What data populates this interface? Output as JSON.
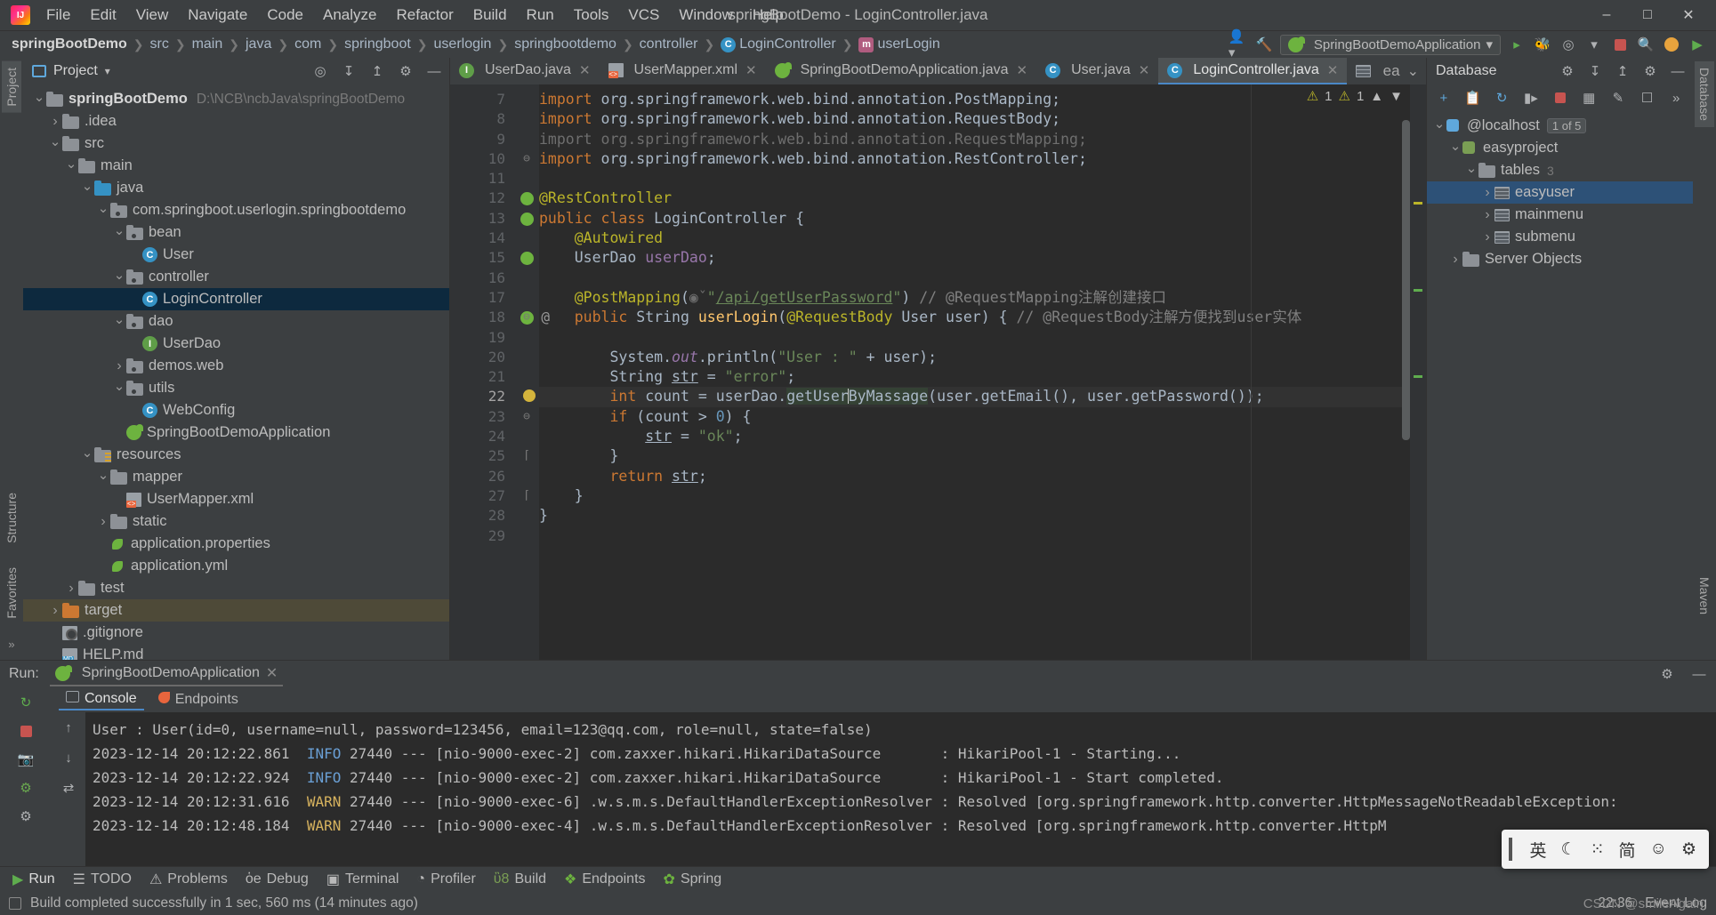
{
  "window": {
    "title": "springBootDemo - LoginController.java",
    "minimize": "–",
    "maximize": "□",
    "close": "✕"
  },
  "menu": [
    "File",
    "Edit",
    "View",
    "Navigate",
    "Code",
    "Analyze",
    "Refactor",
    "Build",
    "Run",
    "Tools",
    "VCS",
    "Window",
    "Help"
  ],
  "breadcrumb": [
    {
      "label": "springBootDemo",
      "bold": true
    },
    {
      "label": "src"
    },
    {
      "label": "main"
    },
    {
      "label": "java"
    },
    {
      "label": "com"
    },
    {
      "label": "springboot"
    },
    {
      "label": "userlogin"
    },
    {
      "label": "springbootdemo"
    },
    {
      "label": "controller"
    },
    {
      "label": "LoginController",
      "icon": "class-icon"
    },
    {
      "label": "userLogin",
      "icon": "method-icon"
    }
  ],
  "navbar_right": {
    "run_config": "SpringBootDemoApplication",
    "icons": [
      "user-settings-icon",
      "hammer-build-icon",
      "run-icon",
      "debug-icon",
      "run-coverage-icon",
      "profiler-icon",
      "stop-icon",
      "search-icon",
      "updates-icon",
      "run-anything-icon"
    ]
  },
  "project_panel": {
    "title": "Project",
    "tools": [
      "select-opened-file-icon",
      "expand-all-icon",
      "collapse-all-icon",
      "settings-icon",
      "hide-icon"
    ],
    "tree": [
      {
        "depth": 0,
        "arrow": "down",
        "icon": "module-folder",
        "name": "springBootDemo",
        "bold": true,
        "path": "D:\\NCB\\ncbJava\\springBootDemo"
      },
      {
        "depth": 1,
        "arrow": "right",
        "icon": "folder",
        "name": ".idea"
      },
      {
        "depth": 1,
        "arrow": "down",
        "icon": "folder",
        "name": "src"
      },
      {
        "depth": 2,
        "arrow": "down",
        "icon": "folder",
        "name": "main"
      },
      {
        "depth": 3,
        "arrow": "down",
        "icon": "folder-blue",
        "name": "java"
      },
      {
        "depth": 4,
        "arrow": "down",
        "icon": "package",
        "name": "com.springboot.userlogin.springbootdemo"
      },
      {
        "depth": 5,
        "arrow": "down",
        "icon": "package",
        "name": "bean"
      },
      {
        "depth": 6,
        "arrow": "none",
        "icon": "class",
        "name": "User"
      },
      {
        "depth": 5,
        "arrow": "down",
        "icon": "package",
        "name": "controller"
      },
      {
        "depth": 6,
        "arrow": "none",
        "icon": "class",
        "name": "LoginController",
        "selected": true
      },
      {
        "depth": 5,
        "arrow": "down",
        "icon": "package",
        "name": "dao"
      },
      {
        "depth": 6,
        "arrow": "none",
        "icon": "interface",
        "name": "UserDao"
      },
      {
        "depth": 5,
        "arrow": "right",
        "icon": "package",
        "name": "demos.web"
      },
      {
        "depth": 5,
        "arrow": "down",
        "icon": "package",
        "name": "utils"
      },
      {
        "depth": 6,
        "arrow": "none",
        "icon": "class",
        "name": "WebConfig"
      },
      {
        "depth": 5,
        "arrow": "none",
        "icon": "spring",
        "name": "SpringBootDemoApplication"
      },
      {
        "depth": 3,
        "arrow": "down",
        "icon": "resource-folder",
        "name": "resources"
      },
      {
        "depth": 4,
        "arrow": "down",
        "icon": "folder",
        "name": "mapper"
      },
      {
        "depth": 5,
        "arrow": "none",
        "icon": "xml",
        "name": "UserMapper.xml"
      },
      {
        "depth": 4,
        "arrow": "right",
        "icon": "folder",
        "name": "static"
      },
      {
        "depth": 4,
        "arrow": "none",
        "icon": "leaf",
        "name": "application.properties"
      },
      {
        "depth": 4,
        "arrow": "none",
        "icon": "leaf",
        "name": "application.yml"
      },
      {
        "depth": 2,
        "arrow": "right",
        "icon": "folder",
        "name": "test"
      },
      {
        "depth": 1,
        "arrow": "right",
        "icon": "folder-orange",
        "name": "target",
        "selectedBrown": true
      },
      {
        "depth": 1,
        "arrow": "none",
        "icon": "gitignore",
        "name": ".gitignore"
      },
      {
        "depth": 1,
        "arrow": "none",
        "icon": "md",
        "name": "HELP.md"
      }
    ]
  },
  "editor": {
    "tabs": [
      {
        "label": "UserDao.java",
        "icon": "interface",
        "active": false
      },
      {
        "label": "UserMapper.xml",
        "icon": "xml",
        "active": false
      },
      {
        "label": "SpringBootDemoApplication.java",
        "icon": "spring",
        "active": false
      },
      {
        "label": "User.java",
        "icon": "class",
        "active": false
      },
      {
        "label": "LoginController.java",
        "icon": "class",
        "active": true
      }
    ],
    "tab_overflow": "ea",
    "status": {
      "warnings": "1",
      "weak_warnings": "1",
      "warning_icon": "⚠",
      "weak_icon": "⚠"
    },
    "lines": [
      {
        "n": 7,
        "tokens": [
          {
            "t": "import ",
            "c": "kw"
          },
          {
            "t": "org.springframework.web.bind.annotation.PostMapping;",
            "c": "plain"
          }
        ]
      },
      {
        "n": 8,
        "tokens": [
          {
            "t": "import ",
            "c": "kw"
          },
          {
            "t": "org.springframework.web.bind.annotation.RequestBody;",
            "c": "plain"
          }
        ]
      },
      {
        "n": 9,
        "tokens": [
          {
            "t": "import org.springframework.web.bind.annotation.RequestMapping;",
            "c": "dim"
          }
        ]
      },
      {
        "n": 10,
        "tokens": [
          {
            "t": "import ",
            "c": "kw"
          },
          {
            "t": "org.springframework.web.bind.annotation.RestController;",
            "c": "plain"
          }
        ],
        "fold": true
      },
      {
        "n": 11,
        "tokens": []
      },
      {
        "n": 12,
        "tokens": [
          {
            "t": "@RestController",
            "c": "ann"
          }
        ],
        "gmark": "bean-icon"
      },
      {
        "n": 13,
        "tokens": [
          {
            "t": "public class ",
            "c": "kw"
          },
          {
            "t": "LoginController {",
            "c": "plain"
          }
        ],
        "gmark": "spring-bean-icon"
      },
      {
        "n": 14,
        "tokens": [
          {
            "t": "    ",
            "c": "plain"
          },
          {
            "t": "@Autowired",
            "c": "ann"
          }
        ]
      },
      {
        "n": 15,
        "tokens": [
          {
            "t": "    UserDao ",
            "c": "plain"
          },
          {
            "t": "userDao",
            "c": "fld"
          },
          {
            "t": ";",
            "c": "plain"
          }
        ],
        "gmark": "autowire-icon"
      },
      {
        "n": 16,
        "tokens": []
      },
      {
        "n": 17,
        "tokens": [
          {
            "t": "    ",
            "c": "plain"
          },
          {
            "t": "@PostMapping",
            "c": "ann"
          },
          {
            "t": "(",
            "c": "plain"
          },
          {
            "t": "◉ˇ",
            "c": "dim"
          },
          {
            "t": "\"",
            "c": "str"
          },
          {
            "t": "/api/getUserPassword",
            "c": "str-under"
          },
          {
            "t": "\"",
            "c": "str"
          },
          {
            "t": ") ",
            "c": "plain"
          },
          {
            "t": "// @RequestMapping注解创建接口",
            "c": "cmt"
          }
        ]
      },
      {
        "n": 18,
        "tokens": [
          {
            "t": "    ",
            "c": "plain"
          },
          {
            "t": "public ",
            "c": "kw"
          },
          {
            "t": "String ",
            "c": "plain"
          },
          {
            "t": "userLogin",
            "c": "mth"
          },
          {
            "t": "(",
            "c": "plain"
          },
          {
            "t": "@RequestBody",
            "c": "ann"
          },
          {
            "t": " User user) { ",
            "c": "plain"
          },
          {
            "t": "// @RequestBody注解方便找到user实体",
            "c": "cmt"
          }
        ],
        "gmark": "endpoint-icon",
        "gmark2": "@",
        "fold": true
      },
      {
        "n": 19,
        "tokens": []
      },
      {
        "n": 20,
        "tokens": [
          {
            "t": "        System.",
            "c": "plain"
          },
          {
            "t": "out",
            "c": "fld-italic"
          },
          {
            "t": ".println(",
            "c": "plain"
          },
          {
            "t": "\"User : \"",
            "c": "str"
          },
          {
            "t": " + user);",
            "c": "plain"
          }
        ]
      },
      {
        "n": 21,
        "tokens": [
          {
            "t": "        String ",
            "c": "plain"
          },
          {
            "t": "str",
            "c": "under"
          },
          {
            "t": " = ",
            "c": "plain"
          },
          {
            "t": "\"error\"",
            "c": "str"
          },
          {
            "t": ";",
            "c": "plain"
          }
        ]
      },
      {
        "n": 22,
        "tokens": [
          {
            "t": "        ",
            "c": "plain"
          },
          {
            "t": "int ",
            "c": "kw"
          },
          {
            "t": "count = userDao.",
            "c": "plain"
          },
          {
            "t": "getUser",
            "c": "hl"
          },
          {
            "t": "CARET",
            "c": "caret"
          },
          {
            "t": "ByMassage",
            "c": "hl"
          },
          {
            "t": "(user.getEmail(), user.getPassword());",
            "c": "plain"
          }
        ],
        "current": true,
        "bulb": true
      },
      {
        "n": 23,
        "tokens": [
          {
            "t": "        ",
            "c": "plain"
          },
          {
            "t": "if ",
            "c": "kw"
          },
          {
            "t": "(count > ",
            "c": "plain"
          },
          {
            "t": "0",
            "c": "num"
          },
          {
            "t": ") {",
            "c": "plain"
          }
        ],
        "fold": true
      },
      {
        "n": 24,
        "tokens": [
          {
            "t": "            ",
            "c": "plain"
          },
          {
            "t": "str",
            "c": "under"
          },
          {
            "t": " = ",
            "c": "plain"
          },
          {
            "t": "\"ok\"",
            "c": "str"
          },
          {
            "t": ";",
            "c": "plain"
          }
        ]
      },
      {
        "n": 25,
        "tokens": [
          {
            "t": "        }",
            "c": "plain"
          }
        ],
        "foldend": true
      },
      {
        "n": 26,
        "tokens": [
          {
            "t": "        ",
            "c": "plain"
          },
          {
            "t": "return ",
            "c": "kw"
          },
          {
            "t": "str",
            "c": "under"
          },
          {
            "t": ";",
            "c": "plain"
          }
        ]
      },
      {
        "n": 27,
        "tokens": [
          {
            "t": "    }",
            "c": "plain"
          }
        ],
        "foldend": true
      },
      {
        "n": 28,
        "tokens": [
          {
            "t": "}",
            "c": "plain"
          }
        ]
      },
      {
        "n": 29,
        "tokens": []
      }
    ]
  },
  "database_panel": {
    "title": "Database",
    "tools": [
      "add-icon",
      "duplicate-icon",
      "refresh-icon",
      "run-sql-icon",
      "stop-icon",
      "table-icon",
      "edit-icon",
      "console-icon",
      "more-icon"
    ],
    "tree": [
      {
        "depth": 0,
        "arrow": "down",
        "icon": "datasource",
        "name": "@localhost",
        "badge": "1 of 5"
      },
      {
        "depth": 1,
        "arrow": "down",
        "icon": "schema",
        "name": "easyproject"
      },
      {
        "depth": 2,
        "arrow": "down",
        "icon": "folder",
        "name": "tables",
        "count": "3"
      },
      {
        "depth": 3,
        "arrow": "right",
        "icon": "table",
        "name": "easyuser",
        "selected": true
      },
      {
        "depth": 3,
        "arrow": "right",
        "icon": "table",
        "name": "mainmenu"
      },
      {
        "depth": 3,
        "arrow": "right",
        "icon": "table",
        "name": "submenu"
      },
      {
        "depth": 1,
        "arrow": "right",
        "icon": "folder",
        "name": "Server Objects"
      }
    ]
  },
  "run_panel": {
    "label": "Run:",
    "config_name": "SpringBootDemoApplication",
    "tabs": [
      {
        "label": "Console",
        "icon": "console-icon",
        "active": true
      },
      {
        "label": "Endpoints",
        "icon": "endpoints-icon",
        "active": false
      }
    ],
    "console_lines": [
      [
        {
          "t": "User : User(id=0, username=null, password=123456, email=123@qq.com, role=null, state=false)",
          "c": "plain"
        }
      ],
      [
        {
          "t": "2023-12-14 20:12:22.861  ",
          "c": "plain"
        },
        {
          "t": "INFO",
          "c": "info"
        },
        {
          "t": " 27440 --- [nio-9000-exec-2] com.zaxxer.hikari.HikariDataSource       : HikariPool-1 - Starting...",
          "c": "plain"
        }
      ],
      [
        {
          "t": "2023-12-14 20:12:22.924  ",
          "c": "plain"
        },
        {
          "t": "INFO",
          "c": "info"
        },
        {
          "t": " 27440 --- [nio-9000-exec-2] com.zaxxer.hikari.HikariDataSource       : HikariPool-1 - Start completed.",
          "c": "plain"
        }
      ],
      [
        {
          "t": "2023-12-14 20:12:31.616  ",
          "c": "plain"
        },
        {
          "t": "WARN",
          "c": "warn"
        },
        {
          "t": " 27440 --- [nio-9000-exec-6] .w.s.m.s.DefaultHandlerExceptionResolver : Resolved [org.springframework.http.converter.HttpMessageNotReadableException:",
          "c": "plain"
        }
      ],
      [
        {
          "t": "2023-12-14 20:12:48.184  ",
          "c": "plain"
        },
        {
          "t": "WARN",
          "c": "warn"
        },
        {
          "t": " 27440 --- [nio-9000-exec-4] .w.s.m.s.DefaultHandlerExceptionResolver : Resolved [org.springframework.http.converter.HttpM",
          "c": "plain"
        }
      ]
    ],
    "sidebar_icons": [
      "rerun-icon",
      "stop-icon",
      "camera-icon",
      "filter-icon",
      "expand-icon"
    ],
    "nav_icons": [
      "up-arrow-icon",
      "down-arrow-icon",
      "soft-wrap-icon"
    ],
    "head_icons": [
      "settings-icon",
      "hide-icon"
    ]
  },
  "tool_window_bar": [
    {
      "label": "Run",
      "icon": "run-icon",
      "active": true
    },
    {
      "label": "TODO",
      "icon": "todo-icon"
    },
    {
      "label": "Problems",
      "icon": "problems-icon"
    },
    {
      "label": "Debug",
      "icon": "debug-icon"
    },
    {
      "label": "Terminal",
      "icon": "terminal-icon"
    },
    {
      "label": "Profiler",
      "icon": "profiler-icon"
    },
    {
      "label": "Build",
      "icon": "build-icon"
    },
    {
      "label": "Endpoints",
      "icon": "endpoints-icon"
    },
    {
      "label": "Spring",
      "icon": "spring-icon"
    }
  ],
  "left_strip": [
    "Project",
    "Structure",
    "Favorites"
  ],
  "right_strip": [
    "Database",
    "Maven"
  ],
  "status_bar": {
    "message": "Build completed successfully in 1 sec, 560 ms (14 minutes ago)",
    "time": "22:36",
    "event_log": "Event Log"
  },
  "ime_bar": {
    "lang": "英",
    "moon": "☾",
    "dots": "⁙",
    "simplified": "简",
    "emoji": "☺",
    "settings": "⚙"
  },
  "watermark": "CSDN @smileAgain",
  "colors": {
    "accent": "#4a88c7",
    "selection": "#0d293e",
    "editor_bg": "#2b2b2b",
    "panel_bg": "#3c3f41",
    "keyword": "#cc7832",
    "string": "#6a8759",
    "comment": "#808080",
    "annotation": "#bbb529",
    "number": "#6897bb",
    "field": "#9876aa",
    "method": "#ffc66d"
  }
}
